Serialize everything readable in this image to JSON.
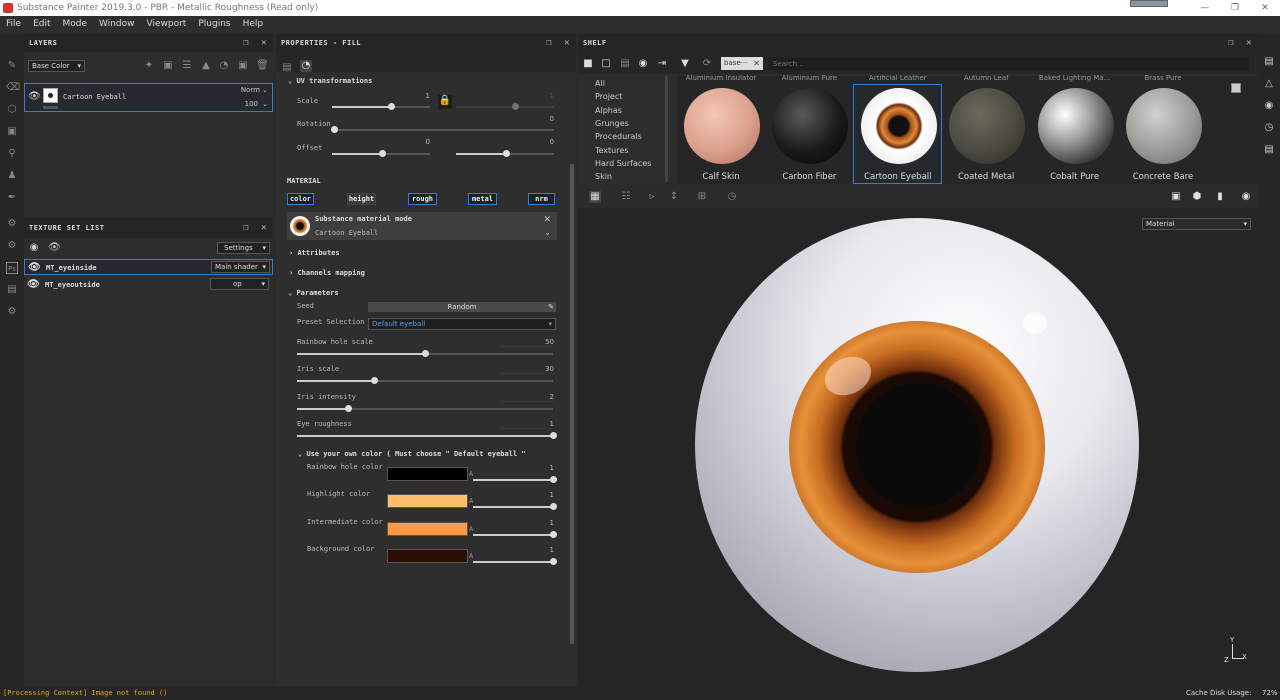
{
  "app": {
    "title": "Substance Painter 2019.3.0 - PBR - Metallic Roughness (Read only)"
  },
  "menu": [
    "File",
    "Edit",
    "Mode",
    "Window",
    "Viewport",
    "Plugins",
    "Help"
  ],
  "layers": {
    "title": "LAYERS",
    "channel": "Base Color",
    "layer_name": "Cartoon Eyeball",
    "blend": "Norm",
    "opacity": "100"
  },
  "texture_set": {
    "title": "TEXTURE SET LIST",
    "settings": "Settings",
    "rows": [
      {
        "name": "MT_eyeinside",
        "shader": "Main shader"
      },
      {
        "name": "MT_eyeoutside",
        "shader": "op"
      }
    ]
  },
  "properties": {
    "title": "PROPERTIES - FILL",
    "uv": {
      "label": "UV transformations",
      "scale": "Scale",
      "scale_val": "1",
      "scale_val2": "1",
      "rotation": "Rotation",
      "rotation_val": "0",
      "offset": "Offset",
      "offset_val1": "0",
      "offset_val2": "0"
    },
    "material_label": "MATERIAL",
    "channels": [
      "color",
      "height",
      "rough",
      "metal",
      "nrm"
    ],
    "mat_mode": "Substance material mode",
    "mat_name": "Cartoon Eyeball",
    "attributes": "Attributes",
    "channels_mapping": "Channels mapping",
    "parameters": "Parameters",
    "seed": "Seed",
    "seed_btn": "Random",
    "preset_label": "Preset Selection",
    "preset_value": "Default eyeball",
    "sliders": [
      {
        "label": "Rainbow hole scale",
        "value": "50",
        "frac": 0.5
      },
      {
        "label": "Iris scale",
        "value": "30",
        "frac": 0.3
      },
      {
        "label": "Iris intensity",
        "value": "2",
        "frac": 0.2
      },
      {
        "label": "Eye roughness",
        "value": "1",
        "frac": 1.0
      }
    ],
    "own_color": "Use your own color ( Must choose \" Default eyeball \"",
    "colors": [
      {
        "label": "Rainbow hole color",
        "value": "1",
        "hex": "#000000"
      },
      {
        "label": "Highlight color",
        "value": "1",
        "hex": "#ffbe6a"
      },
      {
        "label": "Intermediate color",
        "value": "1",
        "hex": "#ff9843"
      },
      {
        "label": "Background color",
        "value": "1",
        "hex": "#2b0f04"
      }
    ],
    "alpha_mark": "A"
  },
  "shelf": {
    "title": "SHELF",
    "filter_tag": "base···",
    "search_placeholder": "Search...",
    "categories": [
      "All",
      "Project",
      "Alphas",
      "Grunges",
      "Procedurals",
      "Textures",
      "Hard Surfaces",
      "Skin"
    ],
    "top_row": [
      "Aluminium Insulator",
      "Aluminium Pure",
      "Artificial Leather",
      "Autumn Leaf",
      "Baked Lighting Ma...",
      "Brass Pure"
    ],
    "items": [
      "Calf Skin",
      "Carbon Fiber",
      "Cartoon Eyeball",
      "Coated Metal",
      "Cobalt Pure",
      "Concrete Bare"
    ]
  },
  "viewport": {
    "mode": "Material"
  },
  "status": {
    "message": "[Processing Context] Image not found ()",
    "cache": "Cache Disk Usage:",
    "cache_pct": "72%"
  }
}
